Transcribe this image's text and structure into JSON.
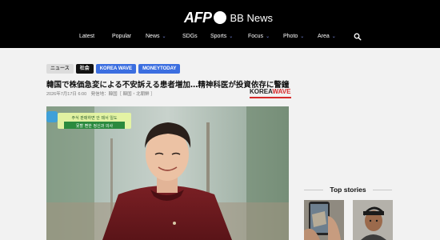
{
  "header": {
    "logo_afp": "AFP",
    "logo_bb": "BB News",
    "nav": [
      {
        "label": "Latest",
        "dropdown": false
      },
      {
        "label": "Popular",
        "dropdown": false
      },
      {
        "label": "News",
        "dropdown": true
      },
      {
        "label": "SDGs",
        "dropdown": false
      },
      {
        "label": "Sports",
        "dropdown": true
      },
      {
        "label": "Focus",
        "dropdown": true
      },
      {
        "label": "Photo",
        "dropdown": true
      },
      {
        "label": "Area",
        "dropdown": true
      }
    ],
    "search_icon": "search-icon",
    "chevron_icon": "chevron-down-icon",
    "chevron_char": "⌄"
  },
  "article": {
    "tags": [
      "ニュース",
      "社会",
      "KOREA WAVE",
      "MONEYTODAY"
    ],
    "headline": "韓国で株価急変による不安訴える患者増加…精神科医が投資依存に警鐘",
    "meta": "2026年7月17日 6:00　発信地：韓国［ 韓国・北朝鮮 ］",
    "source_logo_main": "KOREA",
    "source_logo_accent": "WAVE",
    "photo_caption_line1": "주식 판매하면 안 돼서 일도",
    "photo_caption_line2": "못할 뻔한 정신과 의사"
  },
  "sidebar": {
    "top_stories_title": "Top stories"
  },
  "colors": {
    "header_bg": "#000000",
    "tag_blue": "#3b6ee0",
    "accent_red": "#d62b2b",
    "nav_chevron": "#7b8ce8"
  }
}
